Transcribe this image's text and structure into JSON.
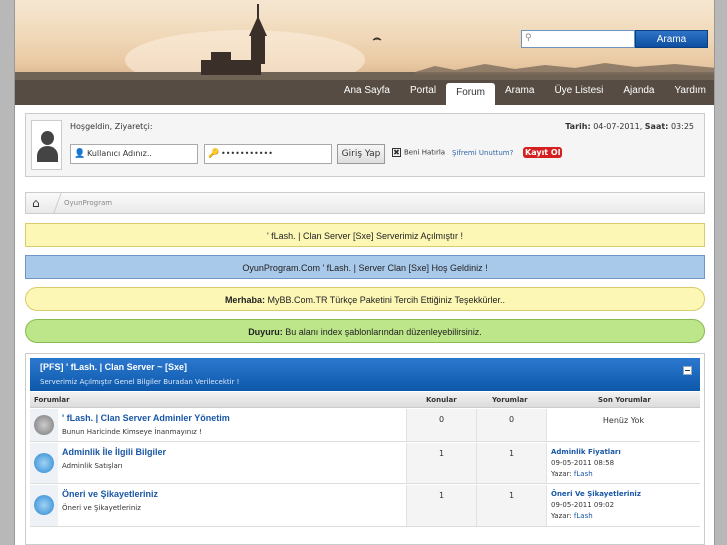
{
  "header": {
    "search_button": "Arama",
    "nav": [
      "Ana Sayfa",
      "Portal",
      "Forum",
      "Arama",
      "Üye Listesi",
      "Ajanda",
      "Yardım"
    ],
    "active_nav": "Forum"
  },
  "login": {
    "welcome": "Hoşgeldin, Ziyaretçi:",
    "date_label": "Tarih:",
    "date_value": "04-07-2011,",
    "time_label": "Saat:",
    "time_value": "03:25",
    "username_placeholder": "Kullanıcı Adınız..",
    "password_value": "•••••••••••",
    "login_button": "Giriş Yap",
    "remember_label": "Beni Hatırla",
    "forgot_link": "Şifremi Unuttum?",
    "register_link": "Kayıt Ol"
  },
  "breadcrumb": {
    "site": "OyunProgram"
  },
  "notices": {
    "n1": "' fLash. | Clan Server [Sxe] Serverimiz Açılmıştır !",
    "n2": "OyunProgram.Com ' fLash. | Server Clan [Sxe] Hoş Geldiniz !",
    "n3_label": "Merhaba:",
    "n3_text": " MyBB.Com.TR Türkçe Paketini Tercih Ettiğiniz Teşekkürler..",
    "n4_label": "Duyuru:",
    "n4_text": " Bu alanı index şablonlarından düzenleyebilirsiniz."
  },
  "category": {
    "title": "[PFS] ' fLash. | Clan Server ~ [Sxe]",
    "description": "Serverimiz Açılmıştır Genel Bilgiler Buradan Verilecektir !",
    "columns": {
      "forums": "Forumlar",
      "threads": "Konular",
      "posts": "Yorumlar",
      "last": "Son Yorumlar"
    },
    "forums": [
      {
        "name": "' fLash. | Clan Server Adminler Yönetim",
        "description": "Bunun Haricinde Kimseye İnanmayınız !",
        "threads": "0",
        "posts": "0",
        "last_none": "Henüz Yok"
      },
      {
        "name": "Adminlik İle İlgili Bilgiler",
        "description": "Adminlik Satışları",
        "threads": "1",
        "posts": "1",
        "last_title": "Adminlik Fiyatları",
        "last_date": "09-05-2011 08:58",
        "last_by": "Yazar:",
        "last_author": "fLash"
      },
      {
        "name": "Öneri ve Şikayetleriniz",
        "description": "Öneri ve Şikayetleriniz",
        "threads": "1",
        "posts": "1",
        "last_title": "Öneri Ve Şikayetleriniz",
        "last_date": "09-05-2011 09:02",
        "last_by": "Yazar:",
        "last_author": "fLash"
      }
    ]
  },
  "colors": {
    "header_blue": "#0d58aa",
    "link_blue": "#1a57a6",
    "notice_yellow": "#fdf7b5",
    "notice_blue": "#a9c9ea",
    "notice_green": "#bde58a",
    "register_red": "#d42020"
  },
  "icons": [
    "search-icon",
    "user-icon",
    "key-icon",
    "home-icon",
    "rss-icon",
    "forum-status-icon",
    "collapse-icon"
  ]
}
